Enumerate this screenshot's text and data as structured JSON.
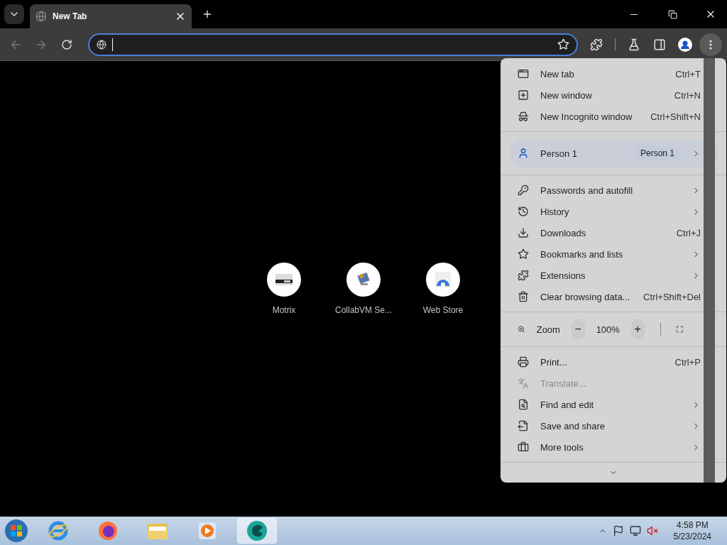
{
  "tabs": [
    {
      "title": "New Tab",
      "selected": true
    }
  ],
  "toolbar": {
    "back_disabled": true,
    "forward_disabled": true,
    "omnibox": {
      "focused": true
    },
    "menu_open": true
  },
  "shortcuts": [
    {
      "label": "Motrix"
    },
    {
      "label": "CollabVM Se..."
    },
    {
      "label": "Web Store"
    }
  ],
  "menu": {
    "sections": [
      [
        {
          "kind": "item",
          "label": "New tab",
          "shortcut": "Ctrl+T",
          "submenu": false,
          "disabled": false
        },
        {
          "kind": "item",
          "label": "New window",
          "shortcut": "Ctrl+N",
          "submenu": false,
          "disabled": false
        },
        {
          "kind": "item",
          "label": "New Incognito window",
          "shortcut": "Ctrl+Shift+N",
          "submenu": false,
          "disabled": false
        }
      ],
      [
        {
          "kind": "profile",
          "label": "Person 1",
          "badge": "Person 1",
          "submenu": true
        }
      ],
      [
        {
          "kind": "item",
          "label": "Passwords and autofill",
          "submenu": true,
          "disabled": false
        },
        {
          "kind": "item",
          "label": "History",
          "submenu": true,
          "disabled": false
        },
        {
          "kind": "item",
          "label": "Downloads",
          "shortcut": "Ctrl+J",
          "submenu": false,
          "disabled": false
        },
        {
          "kind": "item",
          "label": "Bookmarks and lists",
          "submenu": true,
          "disabled": false
        },
        {
          "kind": "item",
          "label": "Extensions",
          "submenu": true,
          "disabled": false
        },
        {
          "kind": "item",
          "label": "Clear browsing data...",
          "shortcut": "Ctrl+Shift+Del",
          "submenu": false,
          "disabled": false
        }
      ],
      [
        {
          "kind": "zoom",
          "label": "Zoom",
          "zoom_out": "−",
          "value": "100%",
          "zoom_in": "+"
        }
      ],
      [
        {
          "kind": "item",
          "label": "Print...",
          "shortcut": "Ctrl+P",
          "submenu": false,
          "disabled": false
        },
        {
          "kind": "item",
          "label": "Translate...",
          "submenu": false,
          "disabled": true
        },
        {
          "kind": "item",
          "label": "Find and edit",
          "submenu": true,
          "disabled": false
        },
        {
          "kind": "item",
          "label": "Save and share",
          "submenu": true,
          "disabled": false
        },
        {
          "kind": "item",
          "label": "More tools",
          "submenu": true,
          "disabled": false
        }
      ],
      [
        {
          "kind": "more"
        }
      ]
    ]
  },
  "taskbar": {
    "apps": [
      {
        "active": false
      },
      {
        "active": false
      },
      {
        "active": false
      },
      {
        "active": false
      },
      {
        "active": true
      }
    ],
    "clock": {
      "time": "4:58 PM",
      "date": "5/23/2024"
    }
  }
}
